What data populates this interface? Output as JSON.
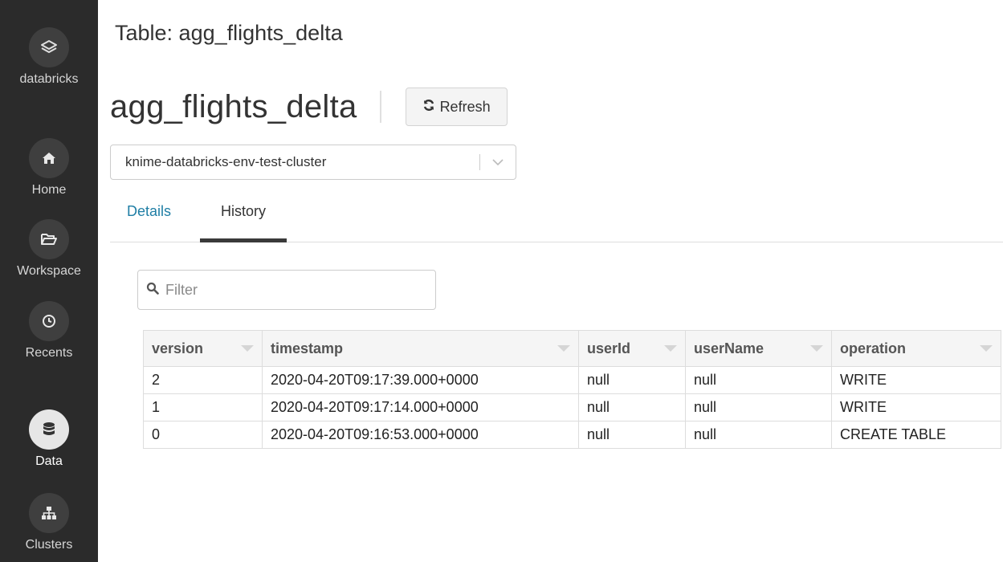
{
  "sidebar": {
    "items": [
      {
        "id": "databricks",
        "label": "databricks",
        "icon": "layers-icon"
      },
      {
        "id": "home",
        "label": "Home",
        "icon": "home-icon"
      },
      {
        "id": "workspace",
        "label": "Workspace",
        "icon": "folder-open-icon"
      },
      {
        "id": "recents",
        "label": "Recents",
        "icon": "clock-icon"
      },
      {
        "id": "data",
        "label": "Data",
        "icon": "database-icon",
        "active": true
      },
      {
        "id": "clusters",
        "label": "Clusters",
        "icon": "sitemap-icon"
      }
    ]
  },
  "header": {
    "window_title": "Table: agg_flights_delta",
    "table_name": "agg_flights_delta",
    "refresh_label": "Refresh"
  },
  "cluster": {
    "selected": "knime-databricks-env-test-cluster"
  },
  "tabs": [
    {
      "label": "Details",
      "active": false
    },
    {
      "label": "History",
      "active": true
    }
  ],
  "filter": {
    "placeholder": "Filter",
    "value": ""
  },
  "history_table": {
    "columns": [
      "version",
      "timestamp",
      "userId",
      "userName",
      "operation"
    ],
    "rows": [
      [
        "2",
        "2020-04-20T09:17:39.000+0000",
        "null",
        "null",
        "WRITE"
      ],
      [
        "1",
        "2020-04-20T09:17:14.000+0000",
        "null",
        "null",
        "WRITE"
      ],
      [
        "0",
        "2020-04-20T09:16:53.000+0000",
        "null",
        "null",
        "CREATE TABLE"
      ]
    ]
  },
  "colors": {
    "sidebar_bg": "#2b2b2b",
    "accent_link": "#1f7ea5"
  }
}
